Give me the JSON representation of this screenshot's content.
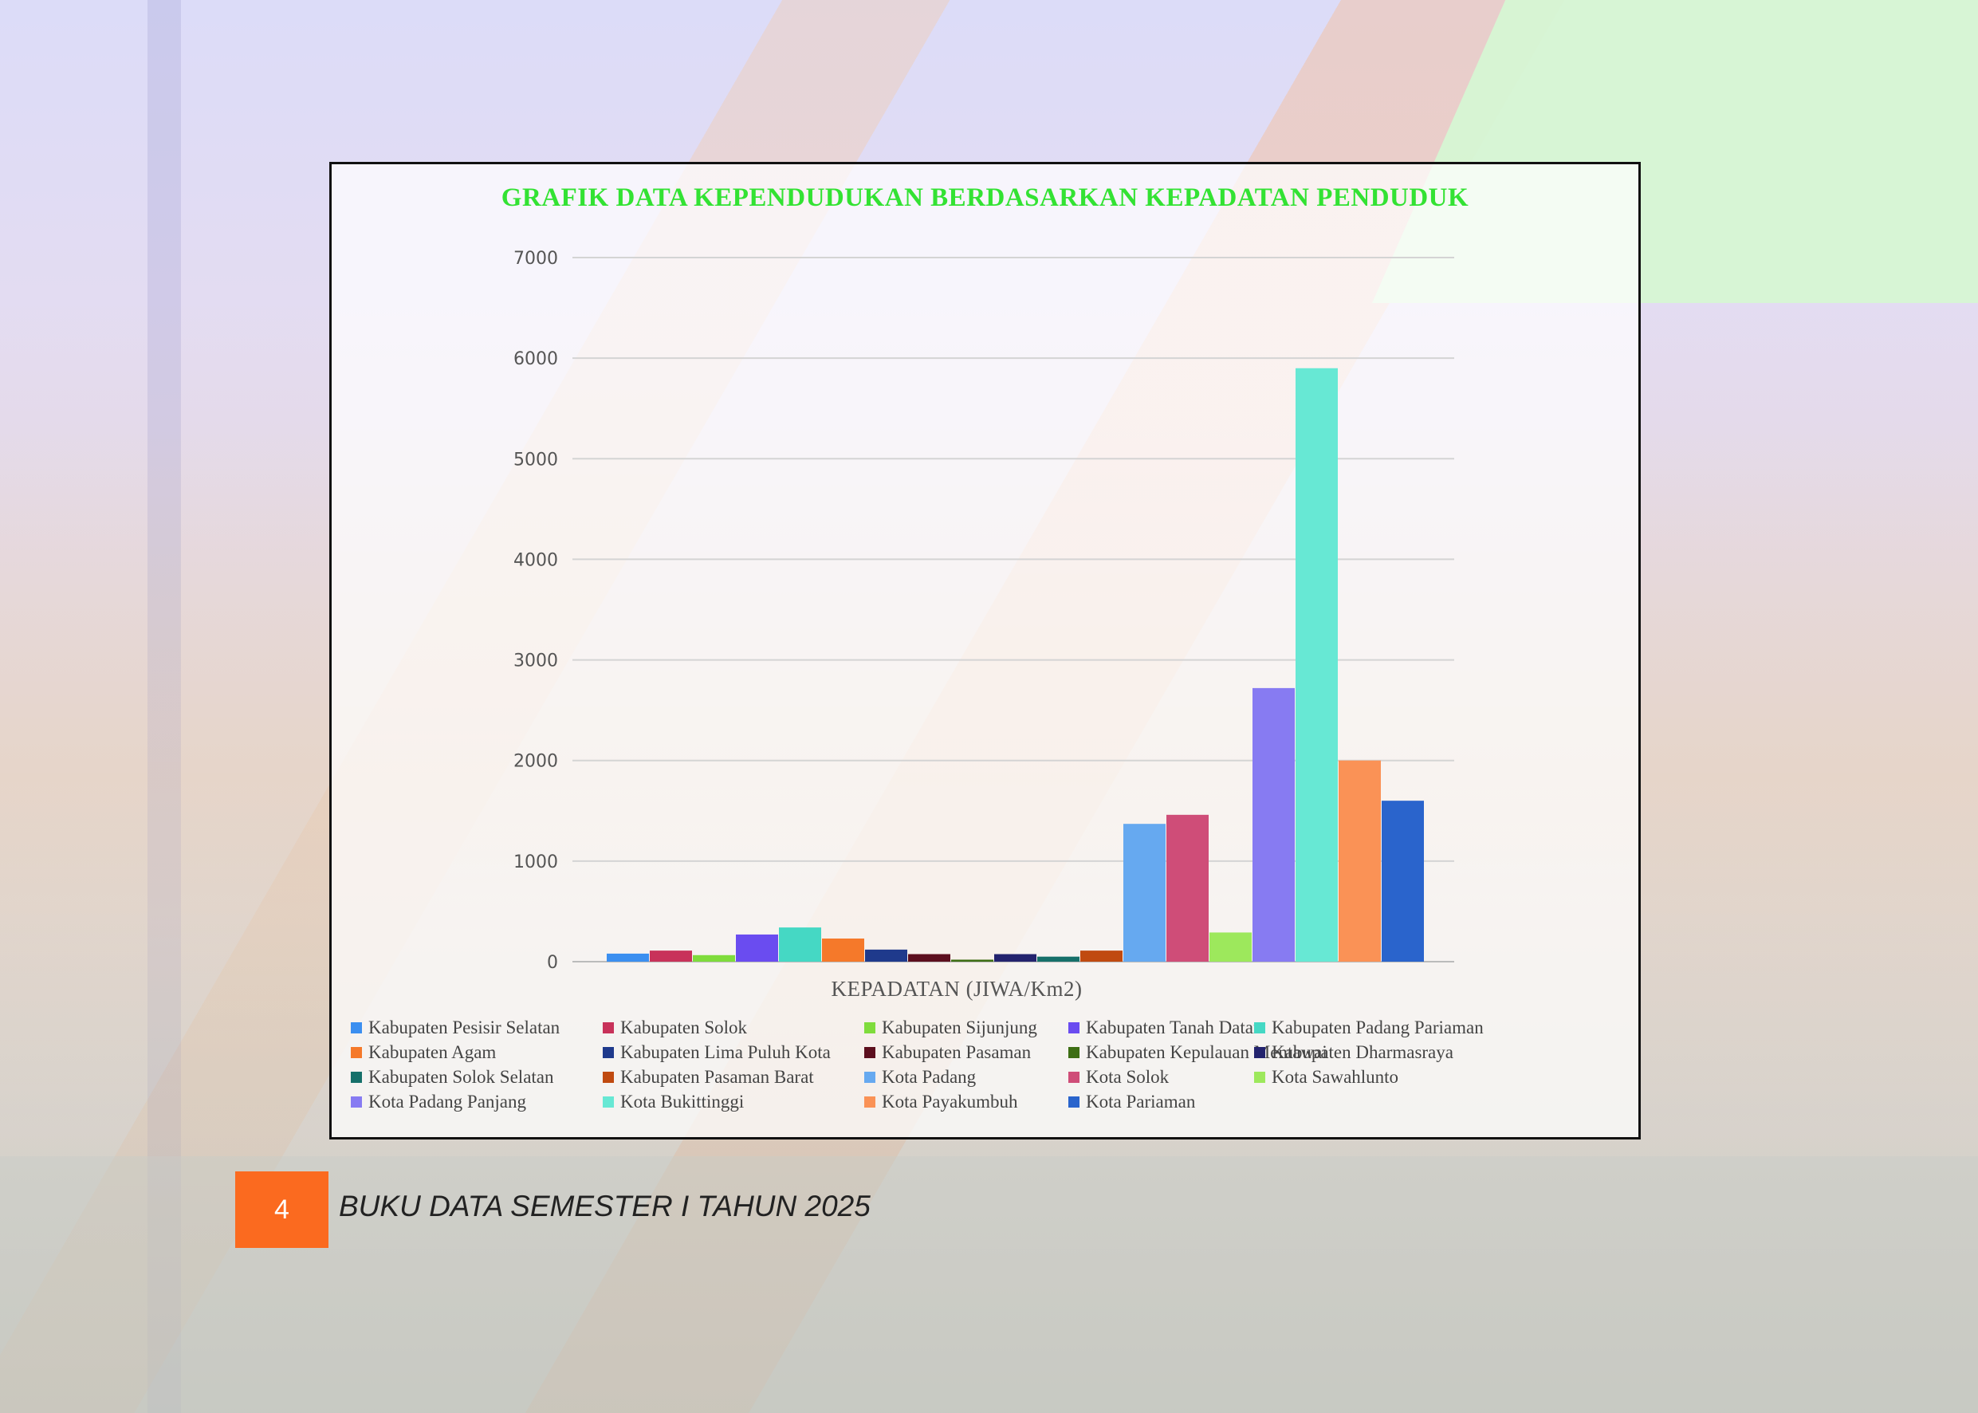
{
  "page": {
    "number": "4",
    "footer_title": "BUKU DATA SEMESTER I TAHUN 2025"
  },
  "colors": {
    "title": "#33e233",
    "page_badge": "#fb6a1f"
  },
  "chart_data": {
    "type": "bar",
    "title": "GRAFIK DATA KEPENDUDUKAN BERDASARKAN KEPADATAN PENDUDUK",
    "xlabel": "KEPADATAN (JIWA/Km2)",
    "ylabel": "",
    "ylim": [
      0,
      7000
    ],
    "yticks": [
      0,
      1000,
      2000,
      3000,
      4000,
      5000,
      6000,
      7000
    ],
    "grid": true,
    "legend_position": "bottom",
    "series": [
      {
        "name": "Kabupaten Pesisir Selatan",
        "value": 80,
        "color": "#3b8ff0"
      },
      {
        "name": "Kabupaten Solok",
        "value": 110,
        "color": "#c8325a"
      },
      {
        "name": "Kabupaten Sijunjung",
        "value": 65,
        "color": "#7fdc3c"
      },
      {
        "name": "Kabupaten Tanah Datar",
        "value": 270,
        "color": "#6a4cf0"
      },
      {
        "name": "Kabupaten Padang Pariaman",
        "value": 340,
        "color": "#45d8c4"
      },
      {
        "name": "Kabupaten Agam",
        "value": 230,
        "color": "#f5792a"
      },
      {
        "name": "Kabupaten Lima Puluh Kota",
        "value": 120,
        "color": "#1f3a8c"
      },
      {
        "name": "Kabupaten Pasaman",
        "value": 75,
        "color": "#5c0f1e"
      },
      {
        "name": "Kabupaten Kepulauan Mentawai",
        "value": 20,
        "color": "#3d6e14"
      },
      {
        "name": "Kabupaten Dharmasraya",
        "value": 75,
        "color": "#23236e"
      },
      {
        "name": "Kabupaten Solok Selatan",
        "value": 50,
        "color": "#16706a"
      },
      {
        "name": "Kabupaten Pasaman Barat",
        "value": 110,
        "color": "#c04a10"
      },
      {
        "name": "Kota Padang",
        "value": 1370,
        "color": "#66a9f0"
      },
      {
        "name": "Kota Solok",
        "value": 1460,
        "color": "#cf4d78"
      },
      {
        "name": "Kota Sawahlunto",
        "value": 290,
        "color": "#9de85c"
      },
      {
        "name": "Kota Padang Panjang",
        "value": 2720,
        "color": "#877bf2"
      },
      {
        "name": "Kota Bukittinggi",
        "value": 5900,
        "color": "#67e8d4"
      },
      {
        "name": "Kota Payakumbuh",
        "value": 2000,
        "color": "#fa9256"
      },
      {
        "name": "Kota Pariaman",
        "value": 1600,
        "color": "#2a64cc"
      }
    ]
  }
}
